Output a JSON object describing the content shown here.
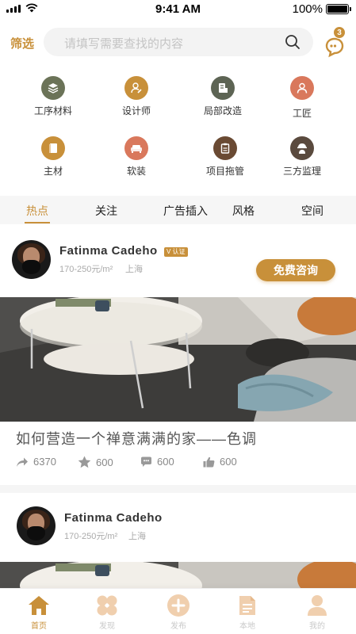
{
  "status_bar": {
    "time": "9:41 AM",
    "battery": "100%"
  },
  "search": {
    "filter_label": "筛选",
    "placeholder": "请填写需要查找的内容",
    "message_count": "3"
  },
  "categories": [
    {
      "label": "工序材料",
      "icon": "layers-icon",
      "color": "#6b7358"
    },
    {
      "label": "设计师",
      "icon": "designer-icon",
      "color": "#c8903a"
    },
    {
      "label": "局部改造",
      "icon": "document-edit-icon",
      "color": "#5d6454"
    },
    {
      "label": "工匠",
      "icon": "person-icon",
      "color": "#d9785c"
    },
    {
      "label": "主材",
      "icon": "book-icon",
      "color": "#c8903a"
    },
    {
      "label": "软装",
      "icon": "sofa-icon",
      "color": "#d9785c"
    },
    {
      "label": "项目拖管",
      "icon": "clipboard-icon",
      "color": "#6a4a33"
    },
    {
      "label": "三方监理",
      "icon": "worker-icon",
      "color": "#5a4a3e"
    }
  ],
  "tabs": [
    {
      "label": "热点",
      "active": true
    },
    {
      "label": "关注",
      "active": false
    },
    {
      "label": "广告插入",
      "active": false
    },
    {
      "label": "风格",
      "active": false
    },
    {
      "label": "空间",
      "active": false
    }
  ],
  "posts": [
    {
      "name": "Fatinma  Cadeho",
      "verified_label": "V 认证",
      "price": "170-250元/m²",
      "city": "上海",
      "consult_label": "免费咨询",
      "title": "如何营造一个禅意满满的家——色调",
      "shares": "6370",
      "favorites": "600",
      "comments": "600",
      "likes": "600"
    },
    {
      "name": "Fatinma  Cadeho",
      "price": "170-250元/m²",
      "city": "上海"
    }
  ],
  "bottom_nav": [
    {
      "label": "首页",
      "icon": "home-icon",
      "active": true
    },
    {
      "label": "发现",
      "icon": "discover-icon",
      "active": false
    },
    {
      "label": "发布",
      "icon": "plus-icon",
      "active": false
    },
    {
      "label": "本地",
      "icon": "notes-icon",
      "active": false
    },
    {
      "label": "我的",
      "icon": "profile-icon",
      "active": false
    }
  ],
  "colors": {
    "accent": "#c8903a",
    "muted_icon": "#f0cfae",
    "tab_bar_bg": "#f6f6f6"
  }
}
